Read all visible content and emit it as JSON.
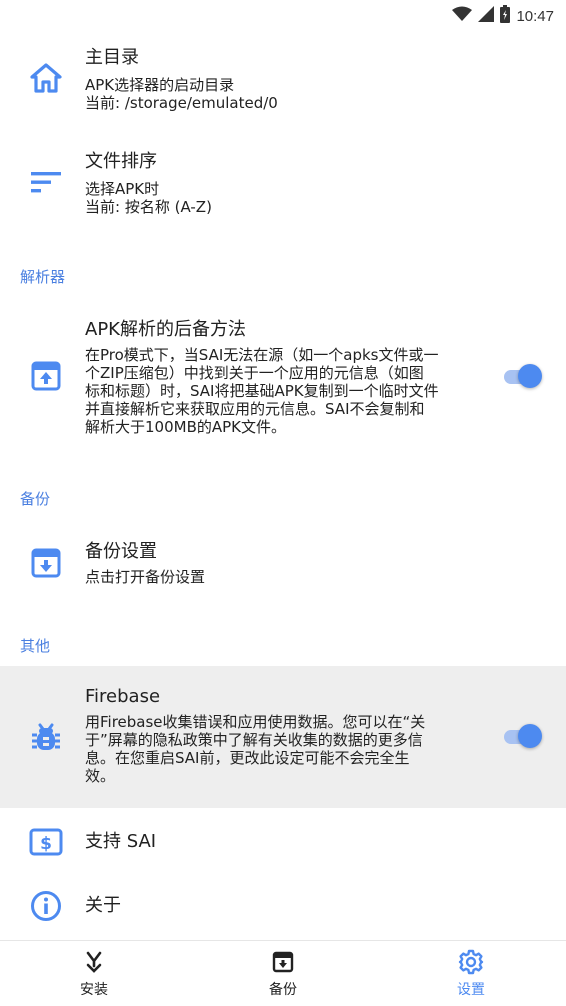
{
  "status_bar": {
    "time": "10:47"
  },
  "prefs": {
    "home_dir": {
      "title": "主目录",
      "summary": [
        "APK选择器的启动目录",
        "当前: /storage/emulated/0"
      ],
      "icon": "home-icon"
    },
    "file_sort": {
      "title": "文件排序",
      "summary": [
        "选择APK时",
        "当前: 按名称 (A-Z)"
      ],
      "icon": "sort-icon"
    },
    "parser_fallback": {
      "title": "APK解析的后备方法",
      "summary": [
        "在Pro模式下，当SAI无法在源（如一个apks文件或一",
        "个ZIP压缩包）中找到关于一个应用的元信息（如图",
        "标和标题）时，SAI将把基础APK复制到一个临时文件",
        "并直接解析它来获取应用的元信息。SAI不会复制和",
        "解析大于100MB的APK文件。"
      ],
      "enabled": true,
      "icon": "upload-box-icon"
    },
    "backup_settings": {
      "title": "备份设置",
      "summary": [
        "点击打开备份设置"
      ],
      "icon": "archive-download-icon"
    },
    "firebase": {
      "title": "Firebase",
      "summary": [
        "用Firebase收集错误和应用使用数据。您可以在“关",
        "于”屏幕的隐私政策中了解有关收集的数据的更多信",
        "息。在您重启SAI前，更改此设定可能不会完全生",
        "效。"
      ],
      "enabled": true,
      "icon": "bug-icon"
    },
    "support": {
      "title": "支持 SAI",
      "icon": "dollar-icon"
    },
    "about": {
      "title": "关于",
      "icon": "info-icon"
    }
  },
  "categories": {
    "parser": "解析器",
    "backup": "备份",
    "other": "其他"
  },
  "bottom_nav": {
    "install": "安装",
    "backup": "备份",
    "settings": "设置",
    "active": "settings"
  },
  "colors": {
    "accent": "#4d8af0",
    "category": "#4a7fe0",
    "highlight": "#eeeeee"
  }
}
